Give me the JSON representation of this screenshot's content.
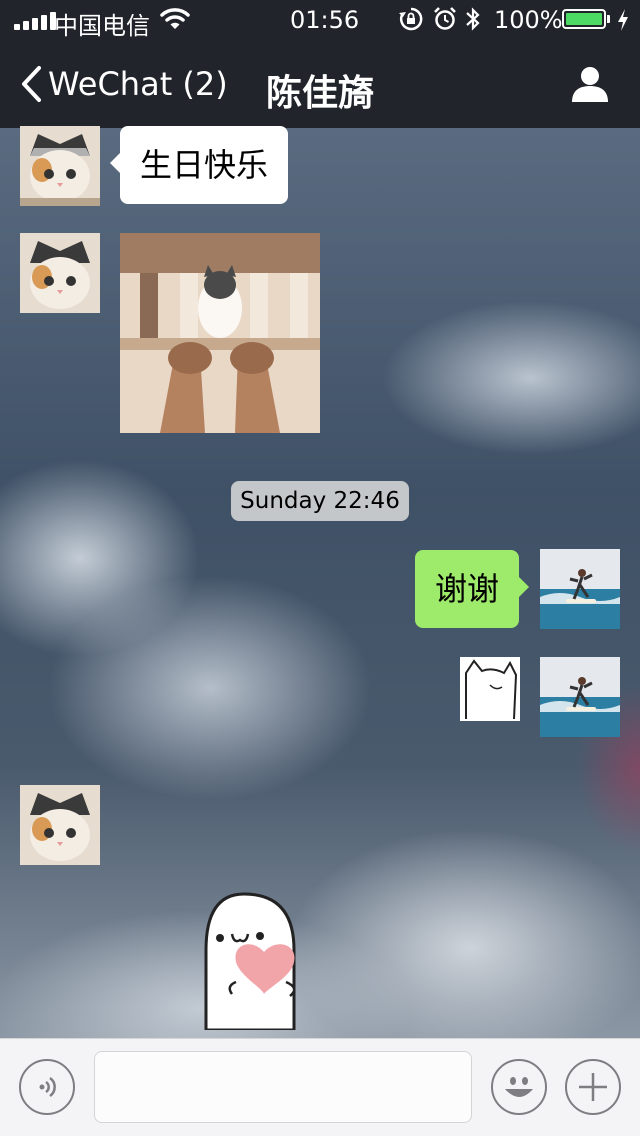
{
  "status_bar": {
    "carrier": "中国电信",
    "time": "01:56",
    "battery_percent": "100%",
    "battery_level": 1.0,
    "icons": [
      "signal-icon",
      "wifi-icon",
      "rotation-lock-icon",
      "alarm-icon",
      "bluetooth-icon",
      "battery-icon",
      "charging-icon"
    ]
  },
  "nav": {
    "back_label": "WeChat (2)",
    "title": "陈佳旖",
    "back_icon": "chevron-left-icon",
    "profile_icon": "person-icon"
  },
  "messages": [
    {
      "side": "left",
      "type": "text",
      "text": "生日快乐",
      "avatar": "cat-avatar"
    },
    {
      "side": "left",
      "type": "image",
      "image": "cat-photo",
      "avatar": "cat-avatar"
    },
    {
      "type": "timestamp",
      "text": "Sunday 22:46"
    },
    {
      "side": "right",
      "type": "text",
      "text": "谢谢",
      "avatar": "surfer-avatar"
    },
    {
      "side": "right",
      "type": "sticker",
      "image": "cat-doodle-sticker",
      "avatar": "surfer-avatar"
    },
    {
      "side": "left",
      "type": "sticker",
      "image": "heart-sticker",
      "avatar": "cat-avatar"
    }
  ],
  "input_bar": {
    "value": "",
    "voice_icon": "voice-icon",
    "emoji_icon": "emoji-icon",
    "add_icon": "plus-icon"
  },
  "colors": {
    "header_bg": "#21252b",
    "bubble_received": "#ffffff",
    "bubble_sent": "#9eea6a",
    "battery_fill": "#4cd964"
  }
}
